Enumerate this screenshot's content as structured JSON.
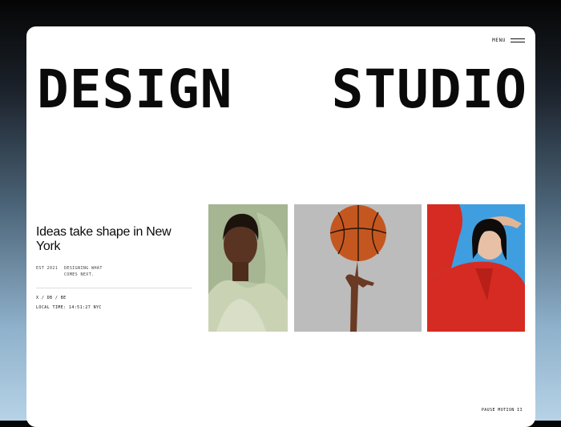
{
  "nav": {
    "menu_label": "MENU"
  },
  "hero": {
    "word_left": "DESIGN",
    "word_right": "STUDIO"
  },
  "intro": {
    "headline": "Ideas take shape in New York",
    "established": "EST 2021",
    "tagline": "DESIGNING WHAT COMES NEXT.",
    "social": "X / DB / BE",
    "local_time": "LOCAL TIME: 14:51:27 NYC"
  },
  "gallery": {
    "images": [
      {
        "icon": "portrait-green-hoodie"
      },
      {
        "icon": "basketball-spin"
      },
      {
        "icon": "portrait-red-coat"
      }
    ]
  },
  "footer": {
    "pause_motion": "PAUSE MOTION II"
  },
  "colors": {
    "accent_red": "#d62b22",
    "sky_blue": "#3f9ee0",
    "sage": "#a6b592"
  }
}
